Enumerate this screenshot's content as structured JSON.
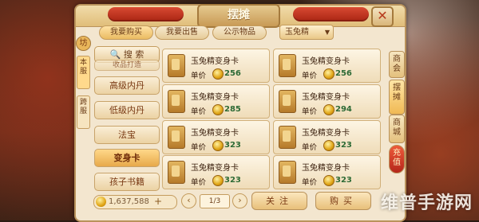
{
  "window": {
    "title": "摆摊",
    "close_label": "✕"
  },
  "tabs": [
    {
      "label": "我要购买",
      "active": true
    },
    {
      "label": "我要出售",
      "active": false
    },
    {
      "label": "公示物品",
      "active": false
    }
  ],
  "dropdown": {
    "selected": "玉兔精"
  },
  "side_tabs": {
    "icon": "坊",
    "server": "本服",
    "cross": "跨服"
  },
  "search": {
    "label": "搜 索"
  },
  "categories": [
    {
      "label": "收品打造",
      "active": false
    },
    {
      "label": "高级内丹",
      "active": false
    },
    {
      "label": "低级内丹",
      "active": false
    },
    {
      "label": "法宝",
      "active": false
    },
    {
      "label": "变身卡",
      "active": true
    },
    {
      "label": "孩子书籍",
      "active": false
    }
  ],
  "items": [
    {
      "name": "玉兔精变身卡",
      "price_label": "单价",
      "price": "256"
    },
    {
      "name": "玉兔精变身卡",
      "price_label": "单价",
      "price": "256"
    },
    {
      "name": "玉兔精变身卡",
      "price_label": "单价",
      "price": "285"
    },
    {
      "name": "玉兔精变身卡",
      "price_label": "单价",
      "price": "294"
    },
    {
      "name": "玉兔精变身卡",
      "price_label": "单价",
      "price": "323"
    },
    {
      "name": "玉兔精变身卡",
      "price_label": "单价",
      "price": "323"
    },
    {
      "name": "玉兔精变身卡",
      "price_label": "单价",
      "price": "323"
    },
    {
      "name": "玉兔精变身卡",
      "price_label": "单价",
      "price": "323"
    }
  ],
  "bottom": {
    "money": "1,637,588",
    "plus": "+",
    "prev": "‹",
    "next": "›",
    "page": "1/3",
    "follow_label": "关注",
    "buy_label": "购买"
  },
  "right_tabs": [
    {
      "label": "商会",
      "active": false
    },
    {
      "label": "摆摊",
      "active": true
    },
    {
      "label": "商城",
      "active": false
    },
    {
      "label": "充值",
      "active": false
    }
  ],
  "watermark": "维普手游网"
}
